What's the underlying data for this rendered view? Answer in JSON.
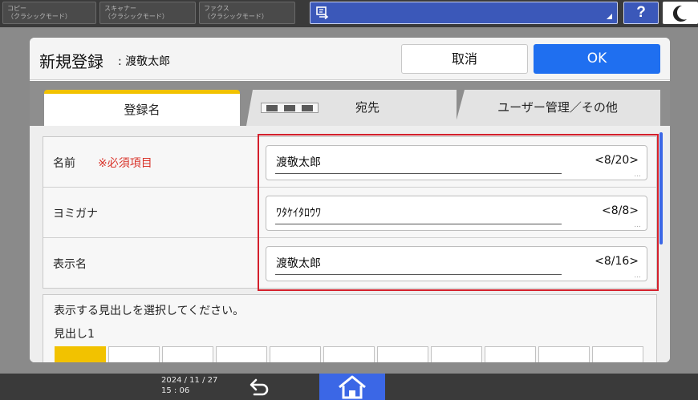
{
  "topbar": {
    "copy": {
      "line1": "コピー",
      "line2": "（クラシックモード）"
    },
    "scanner": {
      "line1": "スキャナー",
      "line2": "（クラシックモード）"
    },
    "fax": {
      "line1": "ファクス",
      "line2": "（クラシックモード）"
    },
    "help_label": "?"
  },
  "dialog": {
    "title": "新規登録",
    "subtitle": ": 渡敬太郎",
    "cancel_label": "取消",
    "ok_label": "OK"
  },
  "tabs": [
    {
      "label": "登録名",
      "active": true
    },
    {
      "label": "宛先",
      "active": false
    },
    {
      "label": "ユーザー管理／その他",
      "active": false
    }
  ],
  "form": {
    "rows": [
      {
        "label": "名前",
        "required": "※必須項目",
        "value": "渡敬太郎",
        "count": "<8/20>"
      },
      {
        "label": "ヨミガナ",
        "required": "",
        "value": "ﾜﾀｹｲﾀﾛｳﾜ",
        "count": "<8/8>"
      },
      {
        "label": "表示名",
        "required": "",
        "value": "渡敬太郎",
        "count": "<8/16>"
      }
    ]
  },
  "heading_select": {
    "prompt": "表示する見出しを選択してください。",
    "heading": "見出し1"
  },
  "bottombar": {
    "date": "2024 / 11 / 27",
    "time": "15 : 06"
  },
  "colors": {
    "accent_blue": "#1f6ff0",
    "tab_active": "#f2c200",
    "required_red": "#d9342b",
    "highlight_red": "#d4202c"
  }
}
